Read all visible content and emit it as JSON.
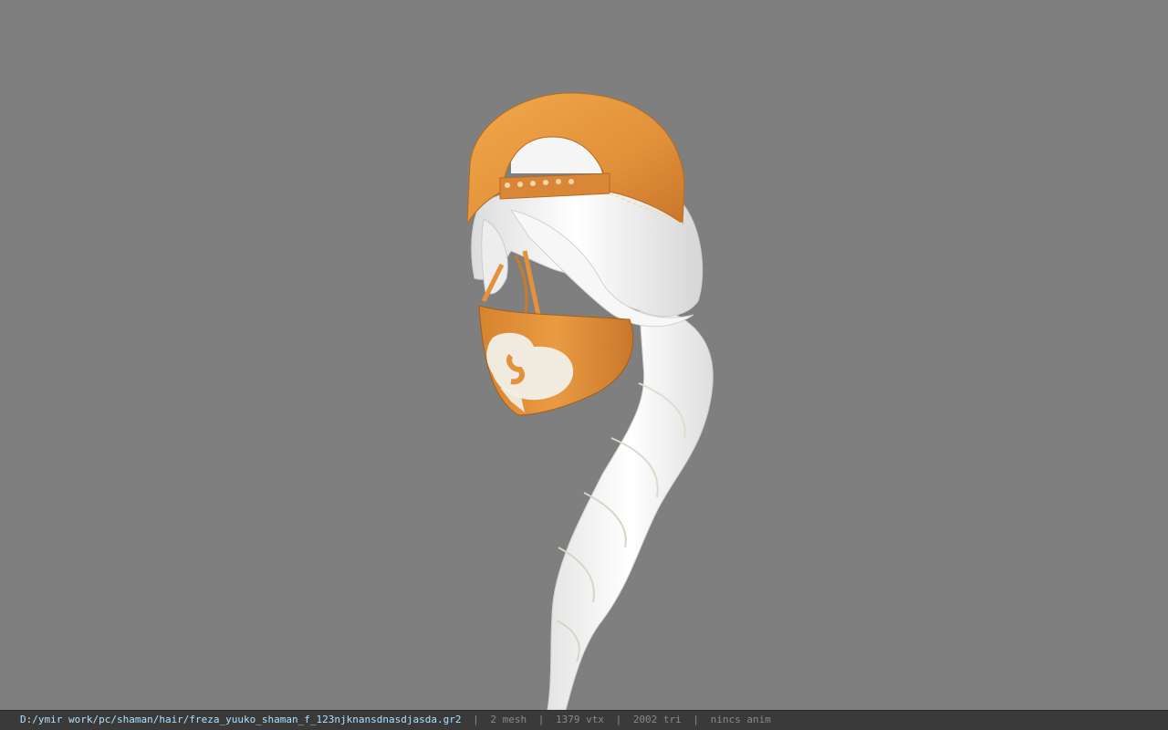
{
  "viewport": {
    "background": "#7f7f7f",
    "model": {
      "cap_color": "#e79a3d",
      "mask_color": "#e3923a",
      "hair_color": "#f2f2f2"
    }
  },
  "statusbar": {
    "file_path": "D:/ymir work/pc/shaman/hair/freza_yuuko_shaman_f_123njknansdnasdjasda.gr2",
    "separator": "|",
    "mesh": "2 mesh",
    "vtx": "1379 vtx",
    "tri": "2002 tri",
    "anim": "nincs anim",
    "path_color": "#aee0ff"
  }
}
